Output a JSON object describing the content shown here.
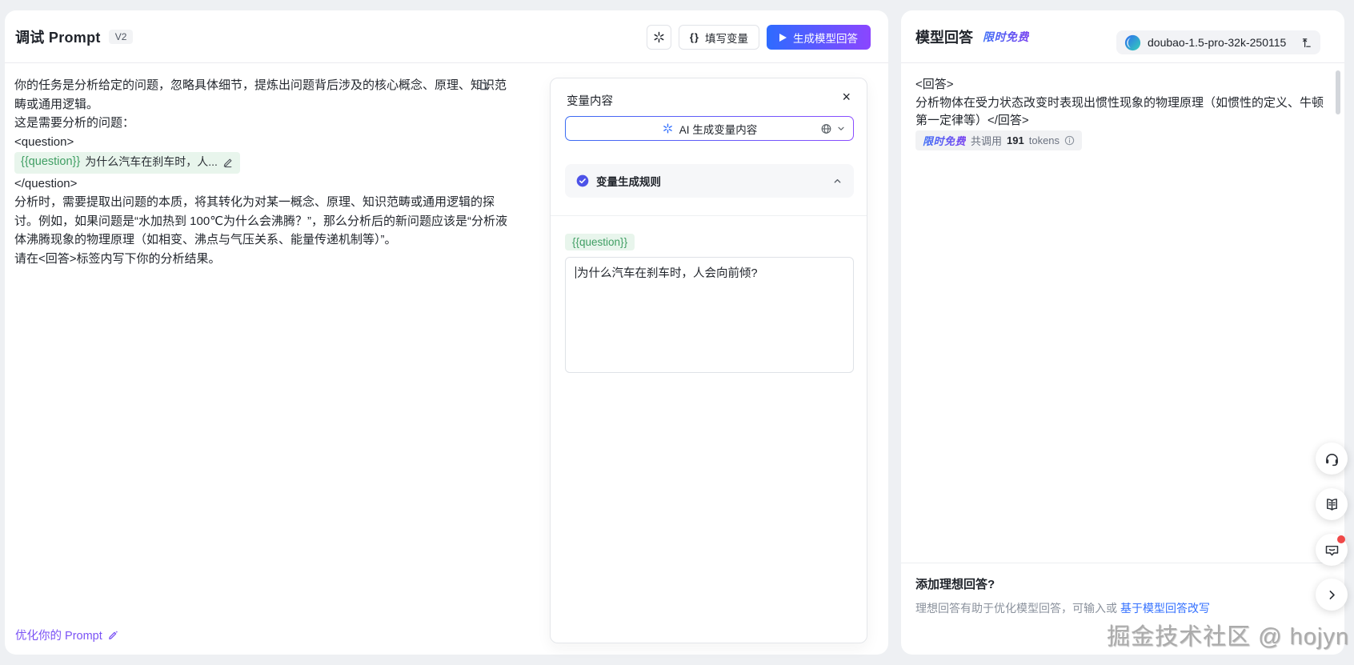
{
  "left_panel": {
    "title": "调试 Prompt",
    "version_badge": "V2",
    "toolbar": {
      "braces_icon": "{}",
      "fill_variables_label": "填写变量",
      "generate_label": "生成模型回答"
    },
    "prompt": {
      "para1": "你的任务是分析给定的问题，忽略具体细节，提炼出问题背后涉及的核心概念、原理、知识范畴或通用逻辑。",
      "line_intro": "这是需要分析的问题：",
      "tag_open": "<question>",
      "variable_chip": "{{question}}",
      "variable_preview": "为什么汽车在刹车时，人...",
      "tag_close": "</question>",
      "para2": "分析时，需要提取出问题的本质，将其转化为对某一概念、原理、知识范畴或通用逻辑的探讨。例如，如果问题是“水加热到 100℃为什么会沸腾？”，那么分析后的新问题应该是“分析液体沸腾现象的物理原理（如相变、沸点与气压关系、能量传递机制等）”。",
      "para3": "请在<回答>标签内写下你的分析结果。"
    },
    "optimize_link": "优化你的 Prompt"
  },
  "variable_panel": {
    "title": "变量内容",
    "close_icon": "×",
    "ai_generate_label": "AI 生成变量内容",
    "rules_label": "变量生成规则",
    "variable_name": "{{question}}",
    "variable_value": "为什么汽车在刹车时，人会向前倾?"
  },
  "response_panel": {
    "title": "模型回答",
    "free_badge": "限时免费",
    "model_name": "doubao-1.5-pro-32k-250115",
    "answer": "<回答>\n分析物体在受力状态改变时表现出惯性现象的物理原理（如惯性的定义、牛顿第一定律等）</回答>",
    "usage": {
      "prefix": "共调用",
      "tokens": "191",
      "unit": "tokens"
    },
    "ideal_answer": {
      "title": "添加理想回答?",
      "desc": "理想回答有助于优化模型回答，可输入或",
      "link": "基于模型回答改写"
    }
  },
  "watermark": "掘金技术社区 @ hojyn",
  "colors": {
    "accent_blue": "#3370ff",
    "accent_purple": "#8b46ff",
    "chip_green": "#3f9e63",
    "chip_green_bg": "#e8f5ec",
    "rules_check": "#4d53e8",
    "badge_red": "#f04848"
  }
}
